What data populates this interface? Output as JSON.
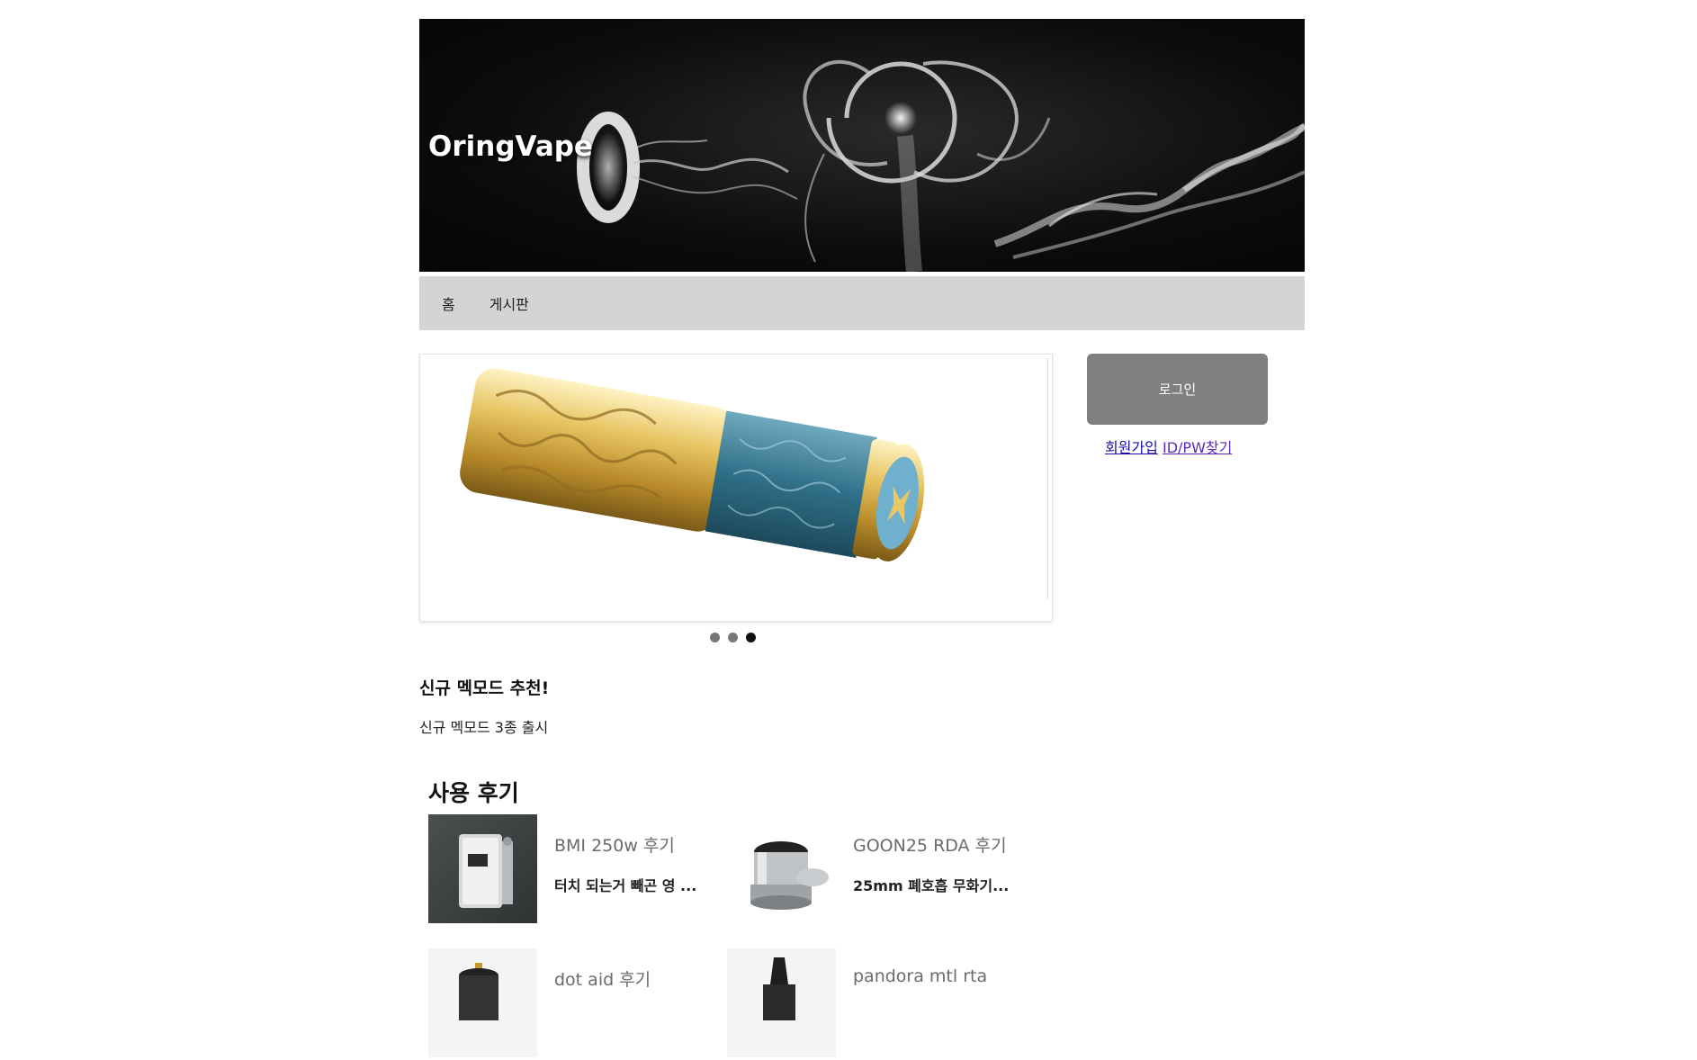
{
  "header": {
    "site_title": "OringVape"
  },
  "nav": {
    "items": [
      "홈",
      "게시판"
    ]
  },
  "slider": {
    "dots": [
      {
        "active": false
      },
      {
        "active": false
      },
      {
        "active": true
      }
    ]
  },
  "login": {
    "button_label": "로그인",
    "signup_link": "회원가입",
    "find_link": "ID/PW찾기"
  },
  "promo": {
    "title": "신규 멕모드 추천!",
    "description": "신규 멕모드 3종 출시"
  },
  "reviews": {
    "heading": "사용 후기",
    "items": [
      {
        "title": "BMI 250w 후기",
        "excerpt": "터치 되는거 빼곤 영 ..."
      },
      {
        "title": "GOON25 RDA 후기",
        "excerpt": "25mm 폐호흡 무화기..."
      },
      {
        "title": "dot aid 후기",
        "excerpt": ""
      },
      {
        "title": "pandora mtl rta",
        "excerpt": ""
      }
    ]
  }
}
